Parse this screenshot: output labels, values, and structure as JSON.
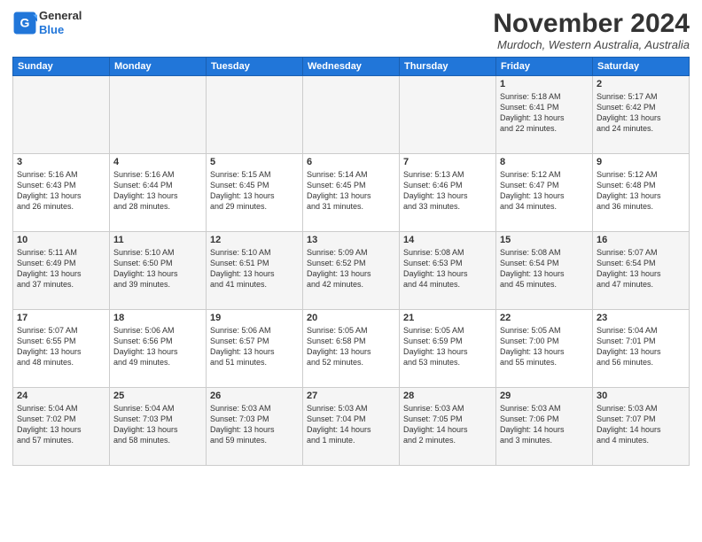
{
  "logo": {
    "general": "General",
    "blue": "Blue"
  },
  "header": {
    "month": "November 2024",
    "location": "Murdoch, Western Australia, Australia"
  },
  "days_of_week": [
    "Sunday",
    "Monday",
    "Tuesday",
    "Wednesday",
    "Thursday",
    "Friday",
    "Saturday"
  ],
  "weeks": [
    [
      {
        "day": "",
        "info": ""
      },
      {
        "day": "",
        "info": ""
      },
      {
        "day": "",
        "info": ""
      },
      {
        "day": "",
        "info": ""
      },
      {
        "day": "",
        "info": ""
      },
      {
        "day": "1",
        "info": "Sunrise: 5:18 AM\nSunset: 6:41 PM\nDaylight: 13 hours\nand 22 minutes."
      },
      {
        "day": "2",
        "info": "Sunrise: 5:17 AM\nSunset: 6:42 PM\nDaylight: 13 hours\nand 24 minutes."
      }
    ],
    [
      {
        "day": "3",
        "info": "Sunrise: 5:16 AM\nSunset: 6:43 PM\nDaylight: 13 hours\nand 26 minutes."
      },
      {
        "day": "4",
        "info": "Sunrise: 5:16 AM\nSunset: 6:44 PM\nDaylight: 13 hours\nand 28 minutes."
      },
      {
        "day": "5",
        "info": "Sunrise: 5:15 AM\nSunset: 6:45 PM\nDaylight: 13 hours\nand 29 minutes."
      },
      {
        "day": "6",
        "info": "Sunrise: 5:14 AM\nSunset: 6:45 PM\nDaylight: 13 hours\nand 31 minutes."
      },
      {
        "day": "7",
        "info": "Sunrise: 5:13 AM\nSunset: 6:46 PM\nDaylight: 13 hours\nand 33 minutes."
      },
      {
        "day": "8",
        "info": "Sunrise: 5:12 AM\nSunset: 6:47 PM\nDaylight: 13 hours\nand 34 minutes."
      },
      {
        "day": "9",
        "info": "Sunrise: 5:12 AM\nSunset: 6:48 PM\nDaylight: 13 hours\nand 36 minutes."
      }
    ],
    [
      {
        "day": "10",
        "info": "Sunrise: 5:11 AM\nSunset: 6:49 PM\nDaylight: 13 hours\nand 37 minutes."
      },
      {
        "day": "11",
        "info": "Sunrise: 5:10 AM\nSunset: 6:50 PM\nDaylight: 13 hours\nand 39 minutes."
      },
      {
        "day": "12",
        "info": "Sunrise: 5:10 AM\nSunset: 6:51 PM\nDaylight: 13 hours\nand 41 minutes."
      },
      {
        "day": "13",
        "info": "Sunrise: 5:09 AM\nSunset: 6:52 PM\nDaylight: 13 hours\nand 42 minutes."
      },
      {
        "day": "14",
        "info": "Sunrise: 5:08 AM\nSunset: 6:53 PM\nDaylight: 13 hours\nand 44 minutes."
      },
      {
        "day": "15",
        "info": "Sunrise: 5:08 AM\nSunset: 6:54 PM\nDaylight: 13 hours\nand 45 minutes."
      },
      {
        "day": "16",
        "info": "Sunrise: 5:07 AM\nSunset: 6:54 PM\nDaylight: 13 hours\nand 47 minutes."
      }
    ],
    [
      {
        "day": "17",
        "info": "Sunrise: 5:07 AM\nSunset: 6:55 PM\nDaylight: 13 hours\nand 48 minutes."
      },
      {
        "day": "18",
        "info": "Sunrise: 5:06 AM\nSunset: 6:56 PM\nDaylight: 13 hours\nand 49 minutes."
      },
      {
        "day": "19",
        "info": "Sunrise: 5:06 AM\nSunset: 6:57 PM\nDaylight: 13 hours\nand 51 minutes."
      },
      {
        "day": "20",
        "info": "Sunrise: 5:05 AM\nSunset: 6:58 PM\nDaylight: 13 hours\nand 52 minutes."
      },
      {
        "day": "21",
        "info": "Sunrise: 5:05 AM\nSunset: 6:59 PM\nDaylight: 13 hours\nand 53 minutes."
      },
      {
        "day": "22",
        "info": "Sunrise: 5:05 AM\nSunset: 7:00 PM\nDaylight: 13 hours\nand 55 minutes."
      },
      {
        "day": "23",
        "info": "Sunrise: 5:04 AM\nSunset: 7:01 PM\nDaylight: 13 hours\nand 56 minutes."
      }
    ],
    [
      {
        "day": "24",
        "info": "Sunrise: 5:04 AM\nSunset: 7:02 PM\nDaylight: 13 hours\nand 57 minutes."
      },
      {
        "day": "25",
        "info": "Sunrise: 5:04 AM\nSunset: 7:03 PM\nDaylight: 13 hours\nand 58 minutes."
      },
      {
        "day": "26",
        "info": "Sunrise: 5:03 AM\nSunset: 7:03 PM\nDaylight: 13 hours\nand 59 minutes."
      },
      {
        "day": "27",
        "info": "Sunrise: 5:03 AM\nSunset: 7:04 PM\nDaylight: 14 hours\nand 1 minute."
      },
      {
        "day": "28",
        "info": "Sunrise: 5:03 AM\nSunset: 7:05 PM\nDaylight: 14 hours\nand 2 minutes."
      },
      {
        "day": "29",
        "info": "Sunrise: 5:03 AM\nSunset: 7:06 PM\nDaylight: 14 hours\nand 3 minutes."
      },
      {
        "day": "30",
        "info": "Sunrise: 5:03 AM\nSunset: 7:07 PM\nDaylight: 14 hours\nand 4 minutes."
      }
    ]
  ]
}
